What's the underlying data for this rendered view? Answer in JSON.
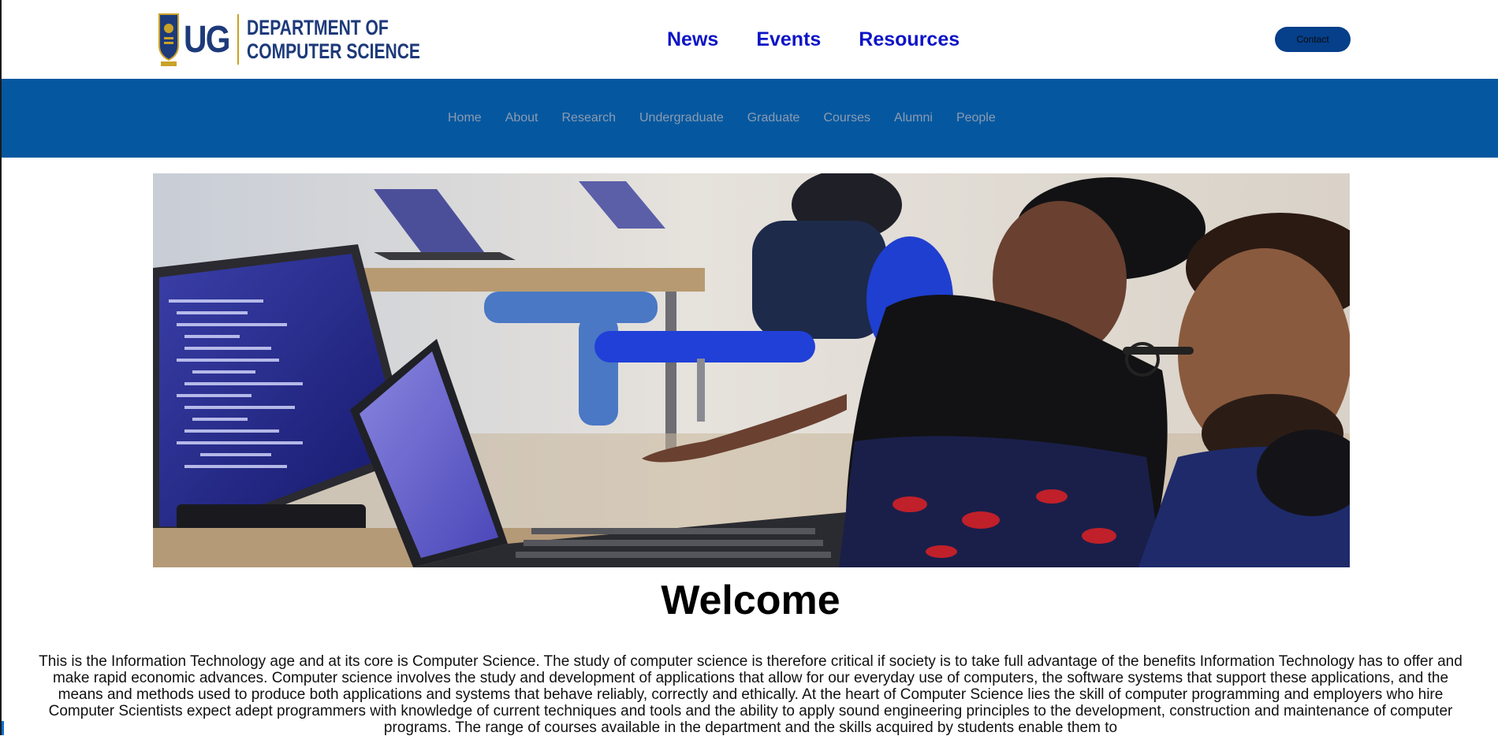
{
  "header": {
    "logo": {
      "mark_text": "UG",
      "dept_line1": "DEPARTMENT OF",
      "dept_line2": "COMPUTER SCIENCE"
    },
    "nav": [
      "News",
      "Events",
      "Resources"
    ],
    "contact_label": "Contact"
  },
  "subnav": {
    "items": [
      "Home",
      "About",
      "Research",
      "Undergraduate",
      "Graduate",
      "Courses",
      "Alumni",
      "People"
    ]
  },
  "main": {
    "welcome_heading": "Welcome",
    "intro_text": "This is the Information Technology age and at its core is Computer Science. The study of computer science is therefore critical if society is to take full advantage of the benefits Information Technology has to offer and make rapid economic advances. Computer science involves the study and development of applications that allow for our everyday use of computers, the software systems that support these applications, and the means and methods used to produce both applications and systems that behave reliably, correctly and ethically. At the heart of Computer Science lies the skill of computer programming and employers who hire Computer Scientists expect adept programmers with knowledge of current techniques and tools and the ability to apply sound engineering principles to the development, construction and maintenance of computer programs. The range of courses available in the department and the skills acquired by students enable them to"
  },
  "colors": {
    "nav_link": "#0d14c7",
    "subnav_bg": "#0558a0",
    "subnav_text": "#8c9bb0",
    "contact_bg": "#063f8a",
    "logo_blue": "#1d3a7a",
    "logo_gold": "#c9a227"
  }
}
